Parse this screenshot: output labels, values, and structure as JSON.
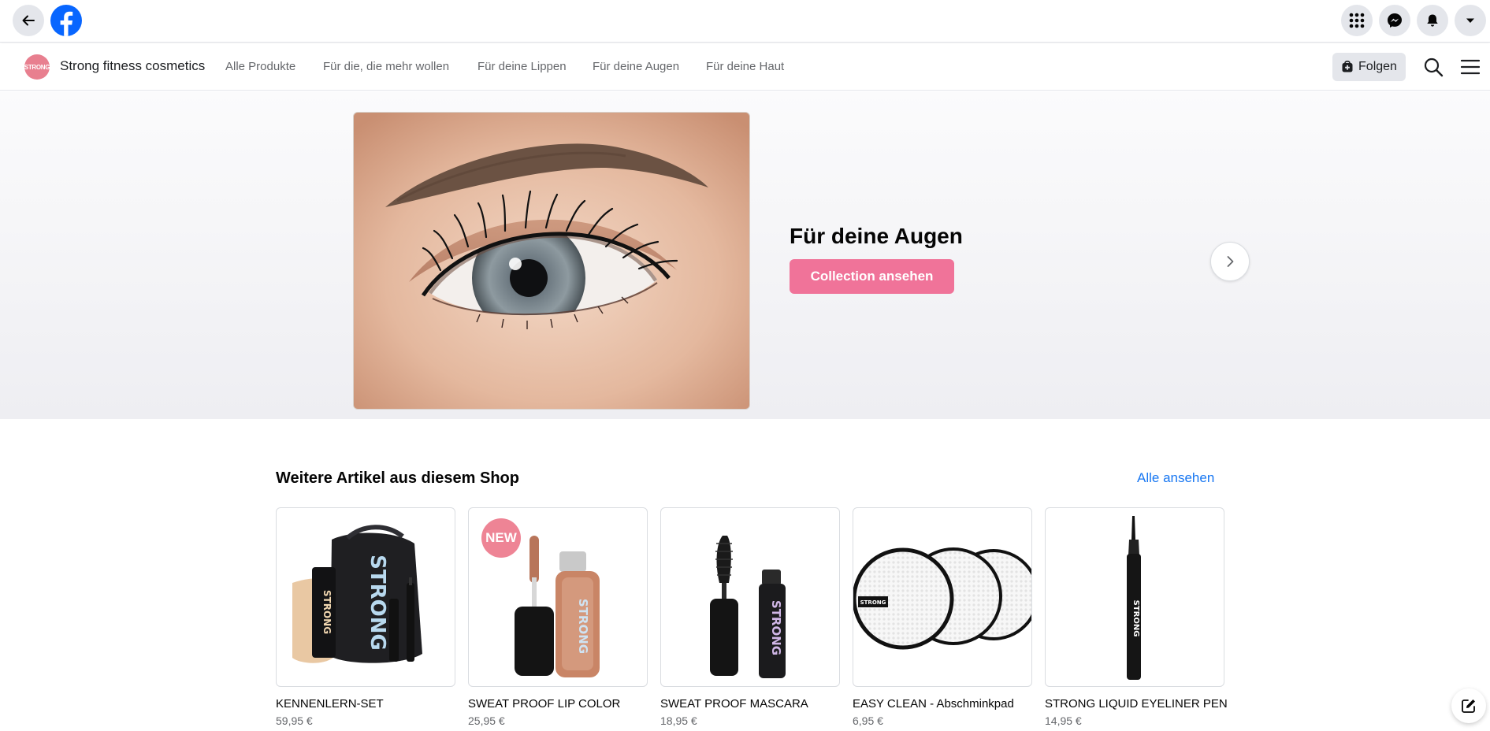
{
  "topbar": {
    "back_icon": "arrow-left-icon",
    "logo_icon": "facebook-logo-icon",
    "right_icons": [
      "grid-menu-icon",
      "messenger-icon",
      "notifications-bell-icon",
      "account-caret-icon"
    ]
  },
  "shop": {
    "avatar_text": "STRONG",
    "name": "Strong fitness cosmetics",
    "nav": [
      "Alle Produkte",
      "Für die, die mehr wollen",
      "Für deine Lippen",
      "Für deine Augen",
      "Für deine Haut"
    ],
    "follow_label": "Folgen"
  },
  "hero": {
    "title": "Für deine Augen",
    "cta_label": "Collection ansehen"
  },
  "more": {
    "title": "Weitere Artikel aus diesem Shop",
    "see_all": "Alle ansehen",
    "badge_new": "NEW",
    "brand": "STRONG",
    "products": [
      {
        "name": "KENNENLERN-SET",
        "price": "59,95 €"
      },
      {
        "name": "SWEAT PROOF LIP COLOR",
        "price": "25,95 €"
      },
      {
        "name": "SWEAT PROOF MASCARA",
        "price": "18,95 €"
      },
      {
        "name": "EASY CLEAN - Abschminkpad",
        "price": "6,95 €"
      },
      {
        "name": "STRONG LIQUID EYELINER PEN",
        "price": "14,95 €"
      }
    ]
  },
  "colors": {
    "accent_pink": "#f07399",
    "link_blue": "#1877f2",
    "facebook_blue": "#0866ff"
  }
}
